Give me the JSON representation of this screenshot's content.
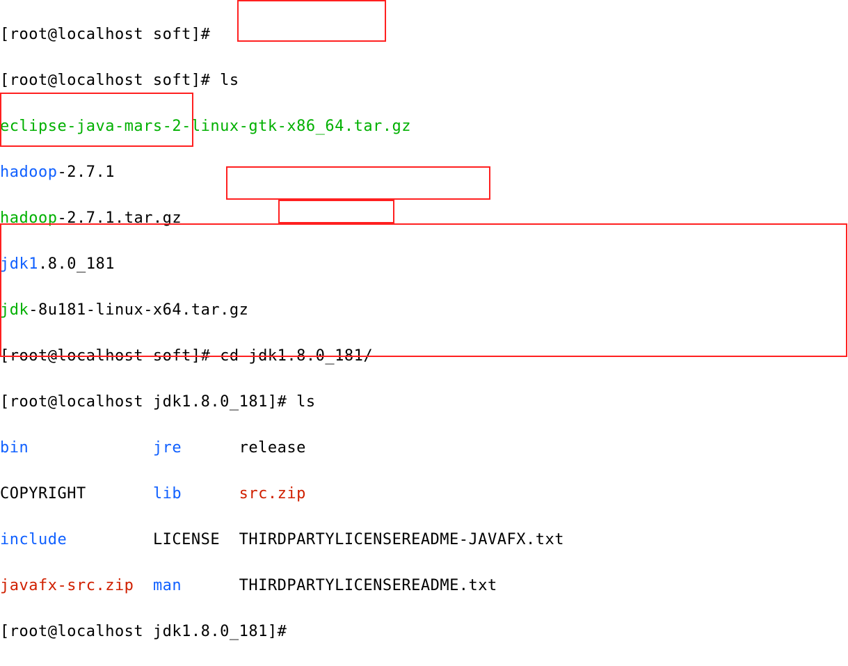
{
  "prompt1": "[root@localhost soft]# ",
  "ls_cmd": "ls",
  "soft_listing": {
    "eclipse": "eclipse-java-mars-2-linux-gtk-x86_64.tar.gz",
    "hadoop_dir_pre": "hadoop",
    "hadoop_dir_suf": "-2.7.1",
    "hadoop_tar_pre": "hadoop",
    "hadoop_tar_suf": "-2.7.1.tar.gz",
    "jdk_dir_pre": "jdk1",
    "jdk_dir_suf": ".8.0_181",
    "jdk_tar_pre": "jdk",
    "jdk_tar_suf_a": "-8u181-linux-x64",
    "jdk_tar_suf_b": ".tar.gz"
  },
  "prompt2": "[root@localhost soft]# ",
  "cd_cmd": "cd jdk1.8.0_181/",
  "prompt3": "[root@localhost jdk1.8.0_181]# ",
  "ls2_cmd": "ls",
  "jdk_rows": {
    "r1c1": "bin",
    "r1c2": "jre",
    "r1c3": "release",
    "r2c1": "COPYRIGHT",
    "r2c2": "lib",
    "r2c3": "src.zip",
    "r3c1": "include",
    "r3c2": "LICENSE",
    "r3c3": "THIRDPARTYLICENSEREADME-JAVAFX.txt",
    "r4c1": "javafx-src.zip",
    "r4c2": "man",
    "r4c3": "THIRDPARTYLICENSEREADME.txt"
  },
  "prompt4": "[root@localhost jdk1.8.0_181]# "
}
